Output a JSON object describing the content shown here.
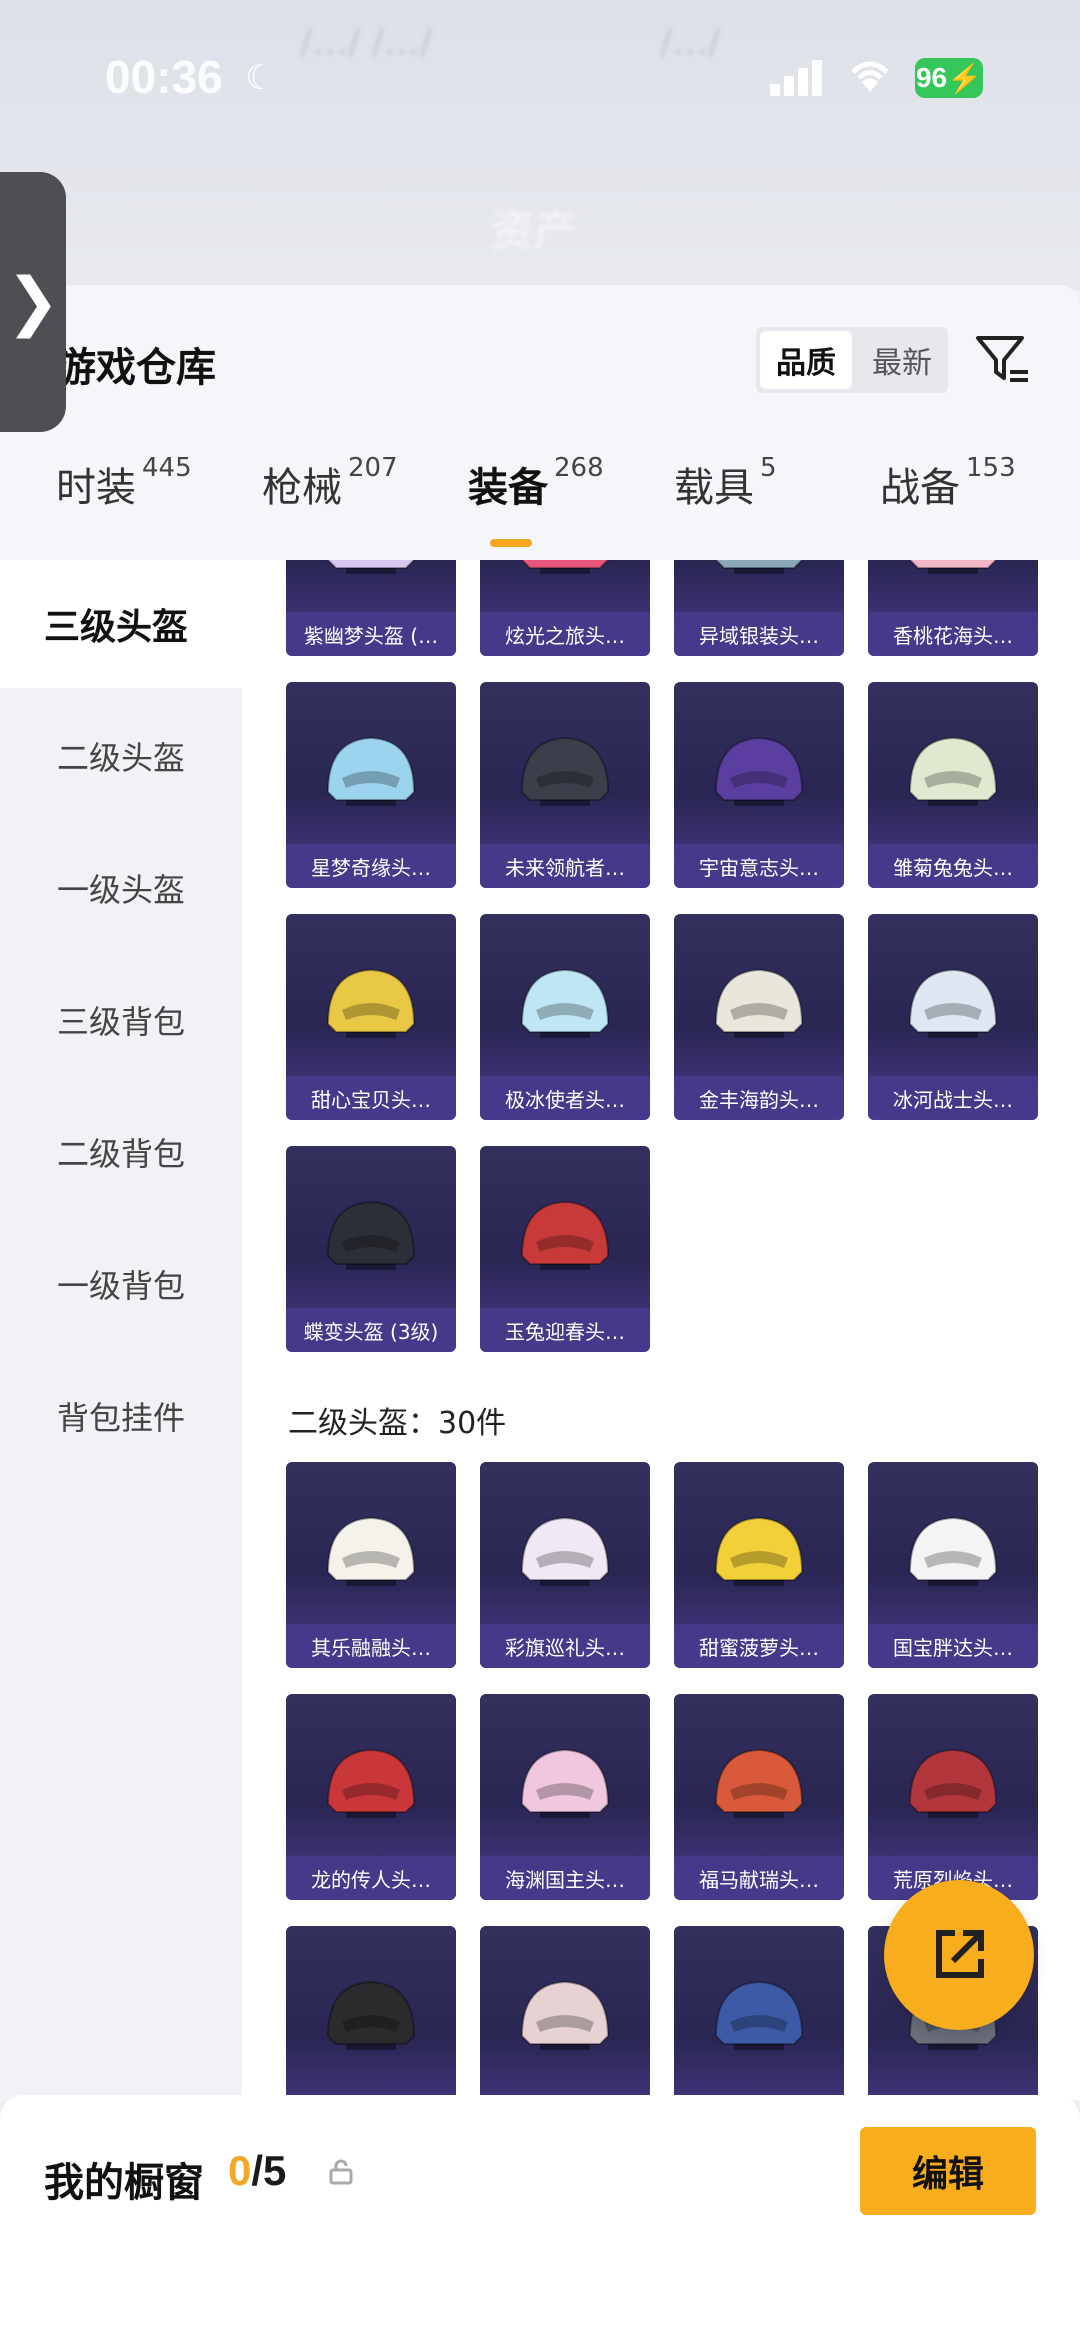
{
  "status": {
    "time": "00:36",
    "battery": "96",
    "ghost_left": "/…/ /…/",
    "ghost_right": "/…/",
    "ghost_title": "资产"
  },
  "header": {
    "title": "游戏仓库",
    "sort_options": [
      "品质",
      "最新"
    ],
    "tabs": [
      {
        "label": "时装",
        "count": "445"
      },
      {
        "label": "枪械",
        "count": "207"
      },
      {
        "label": "装备",
        "count": "268"
      },
      {
        "label": "载具",
        "count": "5"
      },
      {
        "label": "战备",
        "count": "153"
      }
    ]
  },
  "sidebar": {
    "items": [
      "三级头盔",
      "二级头盔",
      "一级头盔",
      "三级背包",
      "二级背包",
      "一级背包",
      "背包挂件"
    ]
  },
  "grid": {
    "level3_items": [
      "紫幽梦头盔 (…",
      "炫光之旅头…",
      "异域银装头…",
      "香桃花海头…",
      "星梦奇缘头…",
      "未来领航者…",
      "宇宙意志头…",
      "雏菊兔兔头…",
      "甜心宝贝头…",
      "极冰使者头…",
      "金丰海韵头…",
      "冰河战士头…",
      "蝶变头盔 (3级)",
      "玉兔迎春头…"
    ],
    "level2_section_title": "二级头盔：30件",
    "level2_items": [
      "其乐融融头…",
      "彩旗巡礼头…",
      "甜蜜菠萝头…",
      "国宝胖达头…",
      "龙的传人头…",
      "海渊国主头…",
      "福马献瑞头…",
      "荒原烈焰头…",
      "",
      "",
      "",
      ""
    ]
  },
  "helmet_colors": [
    "#d9c6ee",
    "#e8557a",
    "#8aa7b5",
    "#f1b6c6",
    "#9cd3ef",
    "#3b3f4a",
    "#5b3fa0",
    "#dfe9cf",
    "#e8c845",
    "#bfe6f4",
    "#e9e6dc",
    "#dfe7f2",
    "#2c2f37",
    "#c83a3a",
    "#f4f2ea",
    "#f0e8f4",
    "#f2d03a",
    "#f4f4f4",
    "#c9373a",
    "#f0c7de",
    "#d95a3a",
    "#b2373d",
    "#2b2b2e",
    "#e6d2d2",
    "#3d5aa6",
    "#6a6f7a"
  ],
  "bottom": {
    "showcase_label": "我的橱窗",
    "current": "0",
    "total": "/5",
    "edit_label": "编辑"
  },
  "icons": [
    "chevron-right-icon",
    "filter-icon",
    "share-icon",
    "lock-icon"
  ]
}
